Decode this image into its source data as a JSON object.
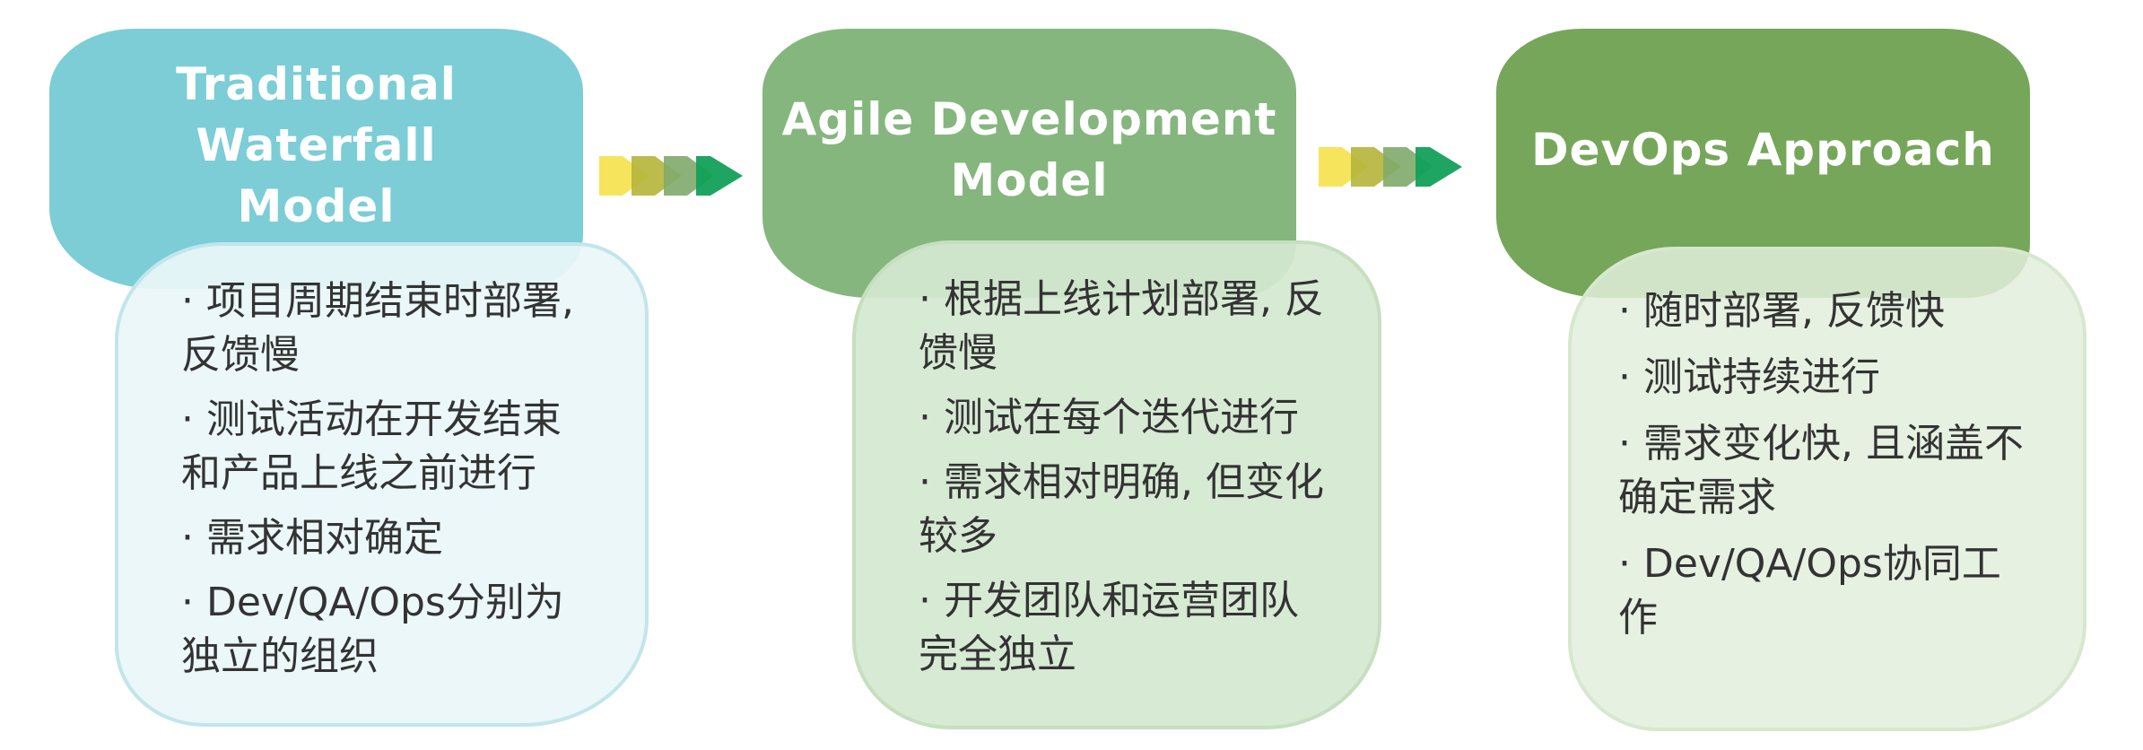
{
  "columns": [
    {
      "title": "Traditional Waterfall\nModel",
      "items": [
        "· 项目周期结束时部署, 反馈慢",
        "· 测试活动在开发结束和产品上线之前进行",
        "· 需求相对确定",
        "· Dev/QA/Ops分别为独立的组织"
      ],
      "header_color": "#7ccdd6",
      "card_color": "#e9f6f8"
    },
    {
      "title": "Agile Development\nModel",
      "items": [
        "· 根据上线计划部署, 反馈慢",
        "· 测试在每个迭代进行",
        "· 需求相对明确, 但变化较多",
        "· 开发团队和运营团队完全独立"
      ],
      "header_color": "#85b67e",
      "card_color": "#d4e8d1"
    },
    {
      "title": "DevOps Approach",
      "items": [
        "· 随时部署, 反馈快",
        "· 测试持续进行",
        "· 需求变化快, 且涵盖不确定需求",
        "· Dev/QA/Ops协同工作"
      ],
      "header_color": "#76a65a",
      "card_color": "#e2efdc"
    }
  ],
  "arrow_colors": [
    "#f5e24a",
    "#b5b53a",
    "#7faa6a",
    "#12a05a"
  ]
}
